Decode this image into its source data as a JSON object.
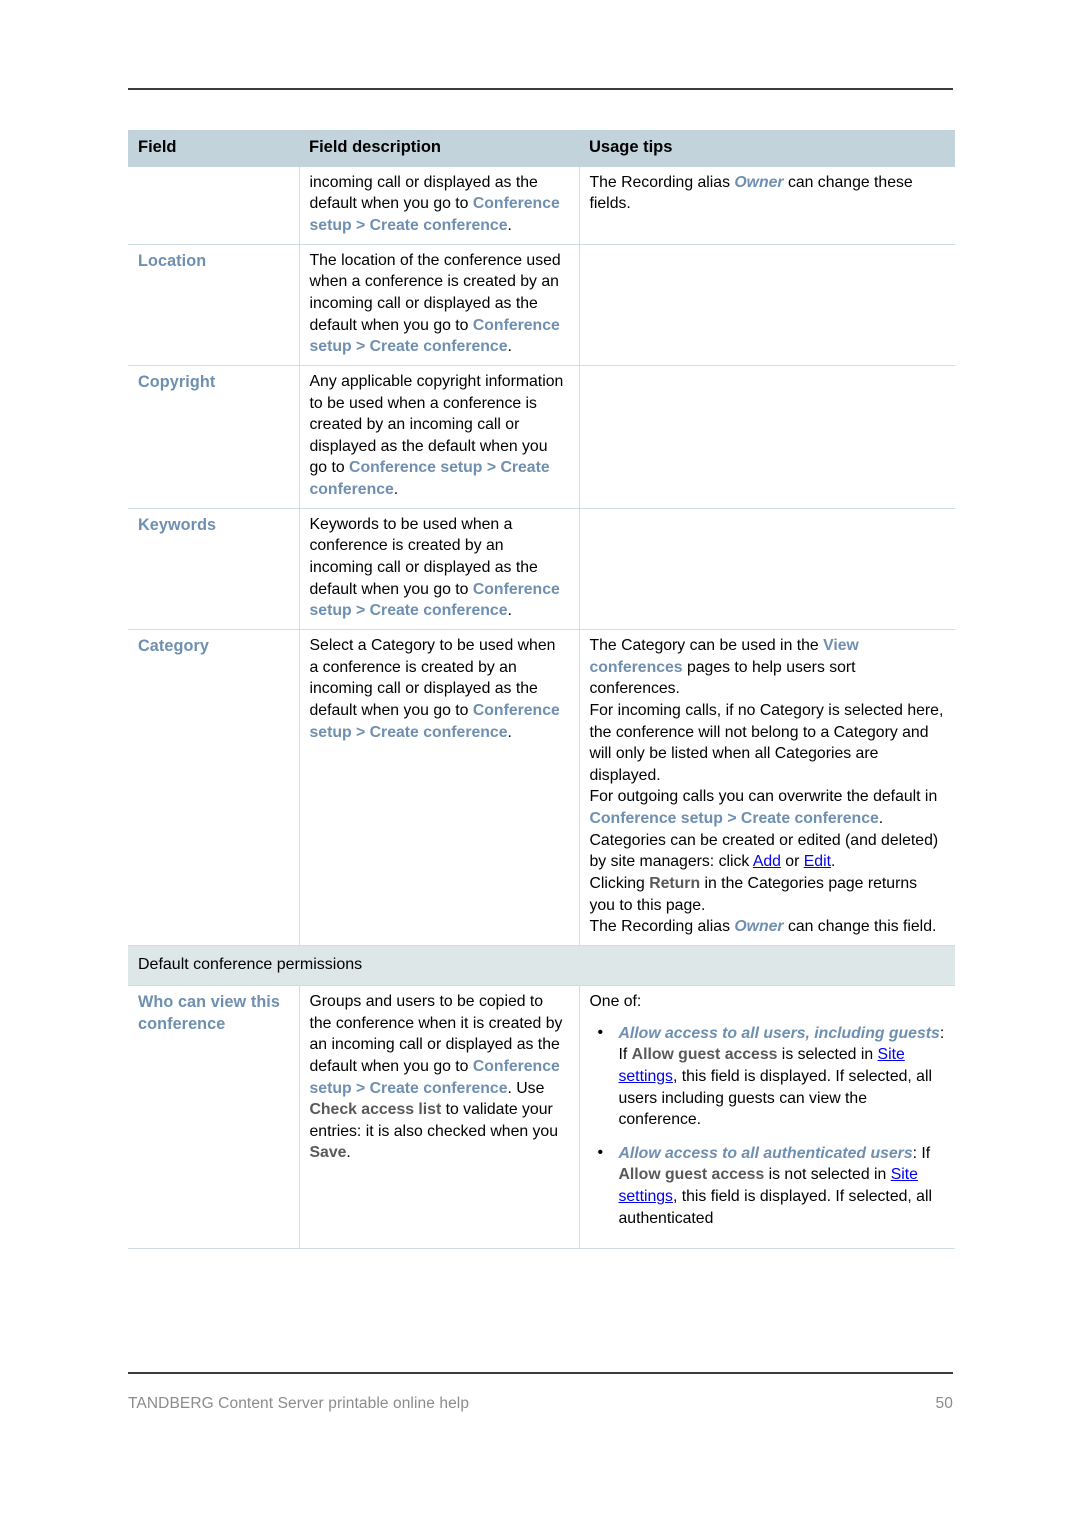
{
  "document": {
    "footer_text": "TANDBERG Content Server printable online help",
    "page_number": "50"
  },
  "table": {
    "headers": {
      "field": "Field",
      "field_description": "Field description",
      "usage_tips": "Usage tips"
    },
    "rows": [
      {
        "field": "",
        "description_parts": {
          "t1": "incoming call or displayed as the default when you go to ",
          "nav1": "Conference setup > Create conference",
          "t2": "."
        },
        "usage_parts": {
          "t1": "The Recording alias ",
          "em1": "Owner",
          "t2": " can change these fields."
        }
      },
      {
        "field": "Location",
        "description_parts": {
          "t1": "The location of the conference used when a conference is created by an incoming call or displayed as the default when you go to ",
          "nav1": "Conference setup > Create conference",
          "t2": "."
        },
        "usage_parts": {
          "t1": "",
          "em1": "",
          "t2": ""
        }
      },
      {
        "field": "Copyright",
        "description_parts": {
          "t1": "Any applicable copyright information to be used when a conference is created by an incoming call or displayed as the default when you go to ",
          "nav1": "Conference setup > Create conference",
          "t2": "."
        },
        "usage_parts": {
          "t1": "",
          "em1": "",
          "t2": ""
        }
      },
      {
        "field": "Keywords",
        "description_parts": {
          "t1": "Keywords to be used when a conference is created by an incoming call or displayed as the default when you go to ",
          "nav1": "Conference setup > Create conference",
          "t2": "."
        },
        "usage_parts": {
          "t1": "",
          "em1": "",
          "t2": ""
        }
      }
    ],
    "category_row": {
      "field": "Category",
      "description": {
        "t1": "Select a Category to be used when a conference is created by an incoming call or displayed as the default when you go to ",
        "nav1": "Conference setup > Create conference",
        "t2": "."
      },
      "usage": {
        "p1_a": "The Category can be used in the ",
        "p1_nav": "View conferences",
        "p1_b": " pages to help users sort conferences.",
        "p2": "For incoming calls, if no Category is selected here, the conference will not belong to a Category and will only be listed when all Categories are displayed.",
        "p3_a": "For outgoing calls you can overwrite the default in ",
        "p3_nav": "Conference setup > Create conference",
        "p3_b": ".",
        "p4_a": "Categories can be created or edited (and deleted) by site managers: click ",
        "p4_link1": "Add",
        "p4_mid": " or ",
        "p4_link2": "Edit",
        "p4_b": ".",
        "p5_a": "Clicking ",
        "p5_bold": "Return",
        "p5_b": " in the Categories page returns you to this page.",
        "p6_a": "The Recording alias ",
        "p6_em": "Owner",
        "p6_b": " can change this field."
      }
    },
    "section_header": "Default conference permissions",
    "permissions_row": {
      "field": "Who can view this conference",
      "description": {
        "t1": "Groups and users to be copied to the conference when it is created by an incoming call or displayed as the default when you go to ",
        "nav1": "Conference setup > Create conference",
        "t2": ". Use ",
        "bold1": "Check access list",
        "t3": " to validate your entries: it is also checked when you ",
        "bold2": "Save",
        "t4": "."
      },
      "usage": {
        "intro": "One of:",
        "bullets": [
          {
            "em": "Allow access to all users, including guests",
            "a": ": If ",
            "bold": "Allow guest access",
            "b": " is selected in ",
            "link": "Site settings",
            "c": ", this field is displayed. If selected, all users including guests can view the conference."
          },
          {
            "em": "Allow access to all authenticated users",
            "a": ": If ",
            "bold": "Allow guest access",
            "b": " is not selected in ",
            "link": "Site settings",
            "c": ", this field is displayed. If selected, all authenticated"
          }
        ]
      }
    }
  },
  "colors": {
    "header_bg": "#c3d3dc",
    "section_bg": "#dde7e7",
    "nav_blue": "#6e8fb0",
    "link_blue": "#0000ee",
    "border": "#cfdde2",
    "rule": "#3b3b3b",
    "footer_gray": "#8b8b8b"
  }
}
